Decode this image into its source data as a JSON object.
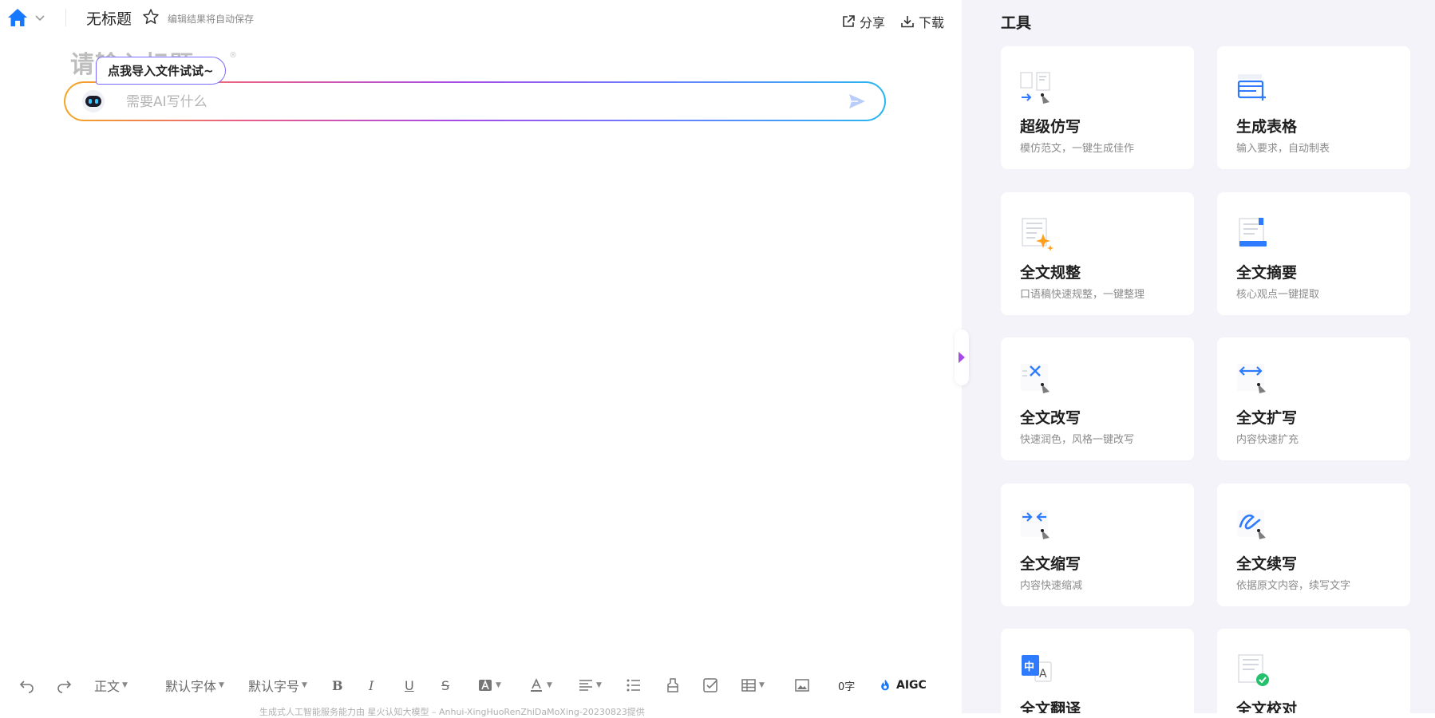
{
  "header": {
    "doc_title": "无标题",
    "autosave_hint": "编辑结果将自动保存",
    "share_label": "分享",
    "download_label": "下载"
  },
  "editor": {
    "title_placeholder": "请输入标题",
    "import_tip": "点我导入文件试试~",
    "ai_input_placeholder": "需要AI写什么"
  },
  "toolbar": {
    "paragraph_style": "正文",
    "font_family": "默认字体",
    "font_size": "默认字号",
    "word_count": "0字",
    "aigc_label": "AIGC"
  },
  "footer_note": "生成式人工智能服务能力由 星火认知大模型 – Anhui-XingHuoRenZhiDaMoXing-20230823提供",
  "tools_panel": {
    "title": "工具",
    "cards": [
      {
        "name": "超级仿写",
        "desc": "模仿范文，一键生成佳作",
        "icon": "imitate-write-icon"
      },
      {
        "name": "生成表格",
        "desc": "输入要求，自动制表",
        "icon": "table-generate-icon"
      },
      {
        "name": "全文规整",
        "desc": "口语稿快速规整，一键整理",
        "icon": "tidy-text-icon"
      },
      {
        "name": "全文摘要",
        "desc": "核心观点一键提取",
        "icon": "summary-icon"
      },
      {
        "name": "全文改写",
        "desc": "快速润色，风格一键改写",
        "icon": "rewrite-icon"
      },
      {
        "name": "全文扩写",
        "desc": "内容快速扩充",
        "icon": "expand-icon"
      },
      {
        "name": "全文缩写",
        "desc": "内容快速缩减",
        "icon": "condense-icon"
      },
      {
        "name": "全文续写",
        "desc": "依据原文内容，续写文字",
        "icon": "continue-write-icon"
      },
      {
        "name": "全文翻译",
        "desc": "",
        "icon": "translate-icon"
      },
      {
        "name": "全文校对",
        "desc": "",
        "icon": "proofread-icon"
      }
    ]
  },
  "colors": {
    "brand_blue": "#1677ff",
    "panel_bg": "#f4f3f9",
    "accent_purple": "#a64be8"
  }
}
